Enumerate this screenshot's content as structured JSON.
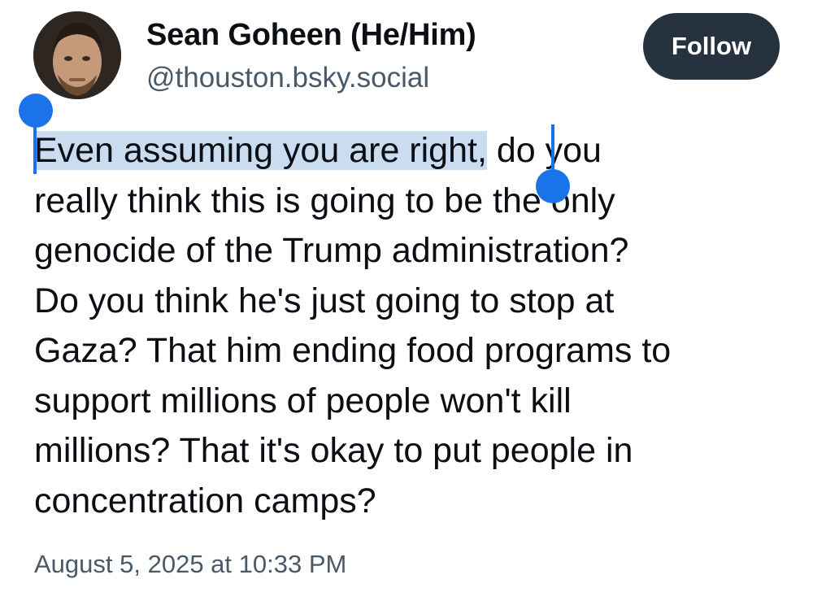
{
  "author": {
    "display_name": "Sean Goheen (He/Him)",
    "handle": "@thouston.bsky.social"
  },
  "follow_button": {
    "label": "Follow"
  },
  "post": {
    "selected_text": "Even assuming you are right,",
    "line1_rest": " do you",
    "lines": [
      "really think this is going to be the only",
      "genocide of the Trump administration?",
      "Do you think he's just going to stop at",
      "Gaza? That him ending food programs to",
      "support millions of people won't kill",
      "millions? That it's okay to put people in",
      "concentration camps?"
    ]
  },
  "timestamp": "August 5, 2025 at 10:33 PM",
  "colors": {
    "follow_bg": "#27323f",
    "selection_highlight": "#c9dcf0",
    "selection_handle": "#1a73e8",
    "secondary_text": "#4a5968"
  }
}
